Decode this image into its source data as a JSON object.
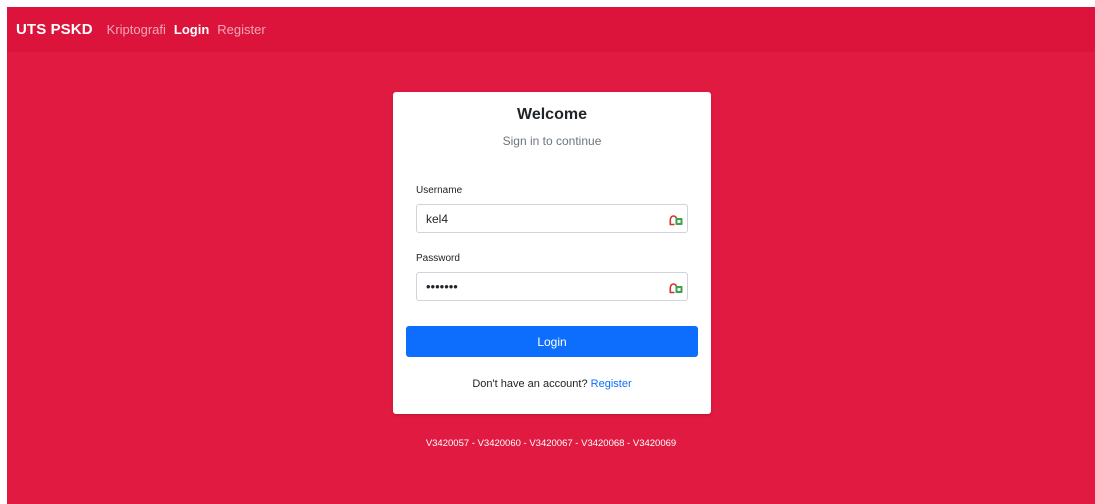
{
  "navbar": {
    "brand": "UTS PSKD",
    "links": [
      "Kriptografi",
      "Login",
      "Register"
    ],
    "active": "Login"
  },
  "card": {
    "title": "Welcome",
    "subtitle": "Sign in to continue",
    "username_label": "Username",
    "username_value": "kel4",
    "password_label": "Password",
    "password_value": "•••••••",
    "password_icon": "password-manager-icon",
    "login_button": "Login",
    "register_prompt": "Don't have an account?",
    "register_link": "Register"
  },
  "footer": {
    "ids": "V3420057 - V3420060 - V3420067 - V3420068 - V3420069"
  },
  "colors": {
    "background": "#e11a42",
    "navbar": "#dc143c",
    "primary": "#0d6efd",
    "card": "#ffffff"
  }
}
